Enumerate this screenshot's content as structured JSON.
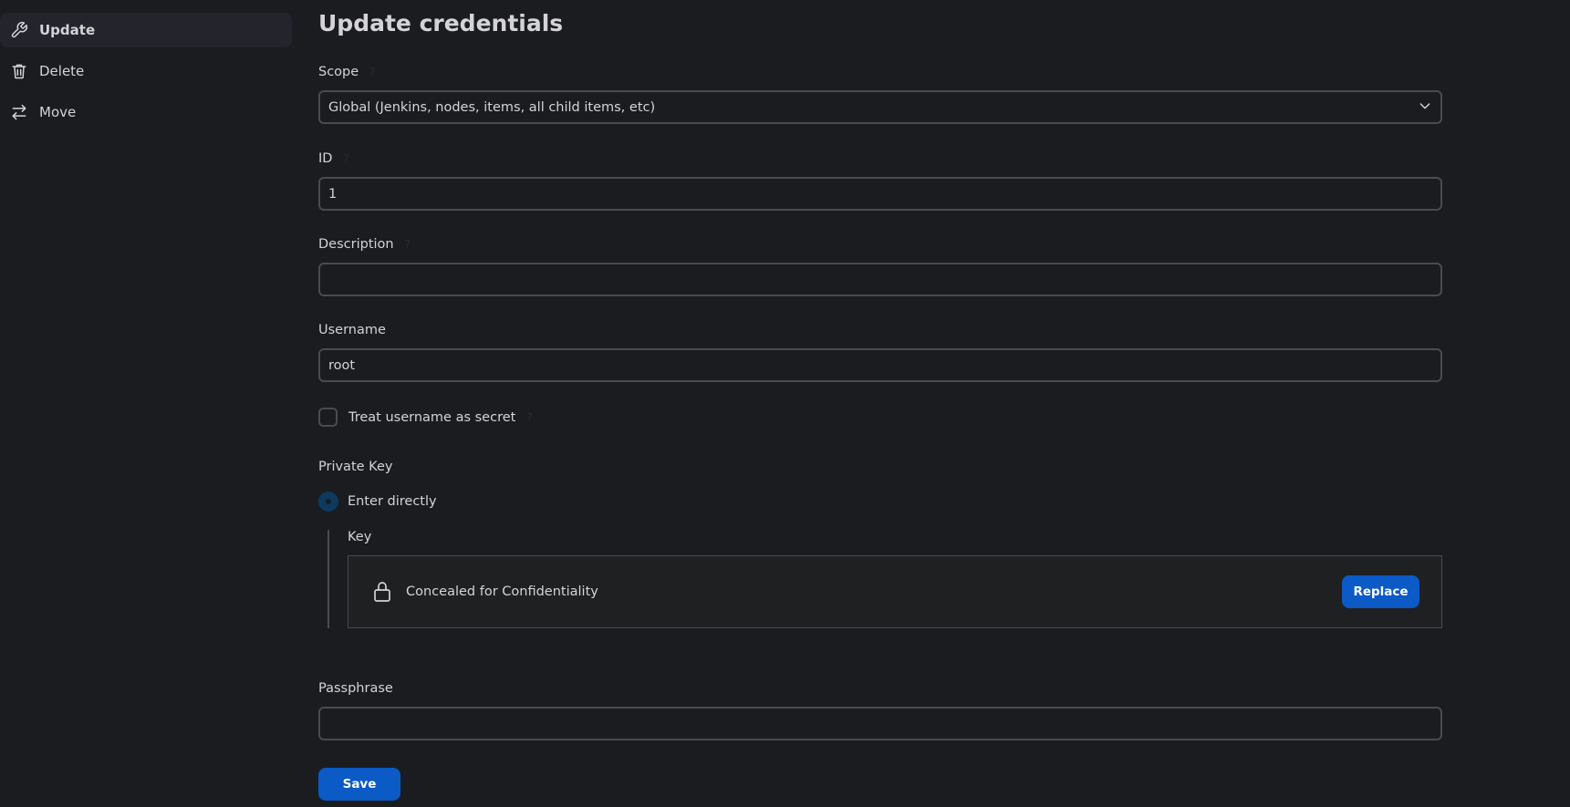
{
  "sidebar": {
    "items": [
      {
        "label": "Update",
        "icon": "wrench-icon",
        "active": true
      },
      {
        "label": "Delete",
        "icon": "trash-icon",
        "active": false
      },
      {
        "label": "Move",
        "icon": "move-arrows-icon",
        "active": false
      }
    ]
  },
  "page": {
    "title": "Update credentials"
  },
  "form": {
    "scope": {
      "label": "Scope",
      "value": "Global (Jenkins, nodes, items, all child items, etc)"
    },
    "id": {
      "label": "ID",
      "value": "1"
    },
    "description": {
      "label": "Description",
      "value": ""
    },
    "username": {
      "label": "Username",
      "value": "root"
    },
    "username_secret": {
      "label": "Treat username as secret",
      "checked": false
    },
    "private_key": {
      "label": "Private Key",
      "option_label": "Enter directly",
      "selected": true,
      "key_label": "Key",
      "concealed_text": "Concealed for Confidentiality",
      "replace_label": "Replace"
    },
    "passphrase": {
      "label": "Passphrase",
      "value": ""
    }
  },
  "actions": {
    "save_label": "Save"
  },
  "colors": {
    "background": "#1b1c1f",
    "primary_button": "#0b5ac5",
    "active_sidebar": "#23242c",
    "input_border": "#4a4b50"
  }
}
